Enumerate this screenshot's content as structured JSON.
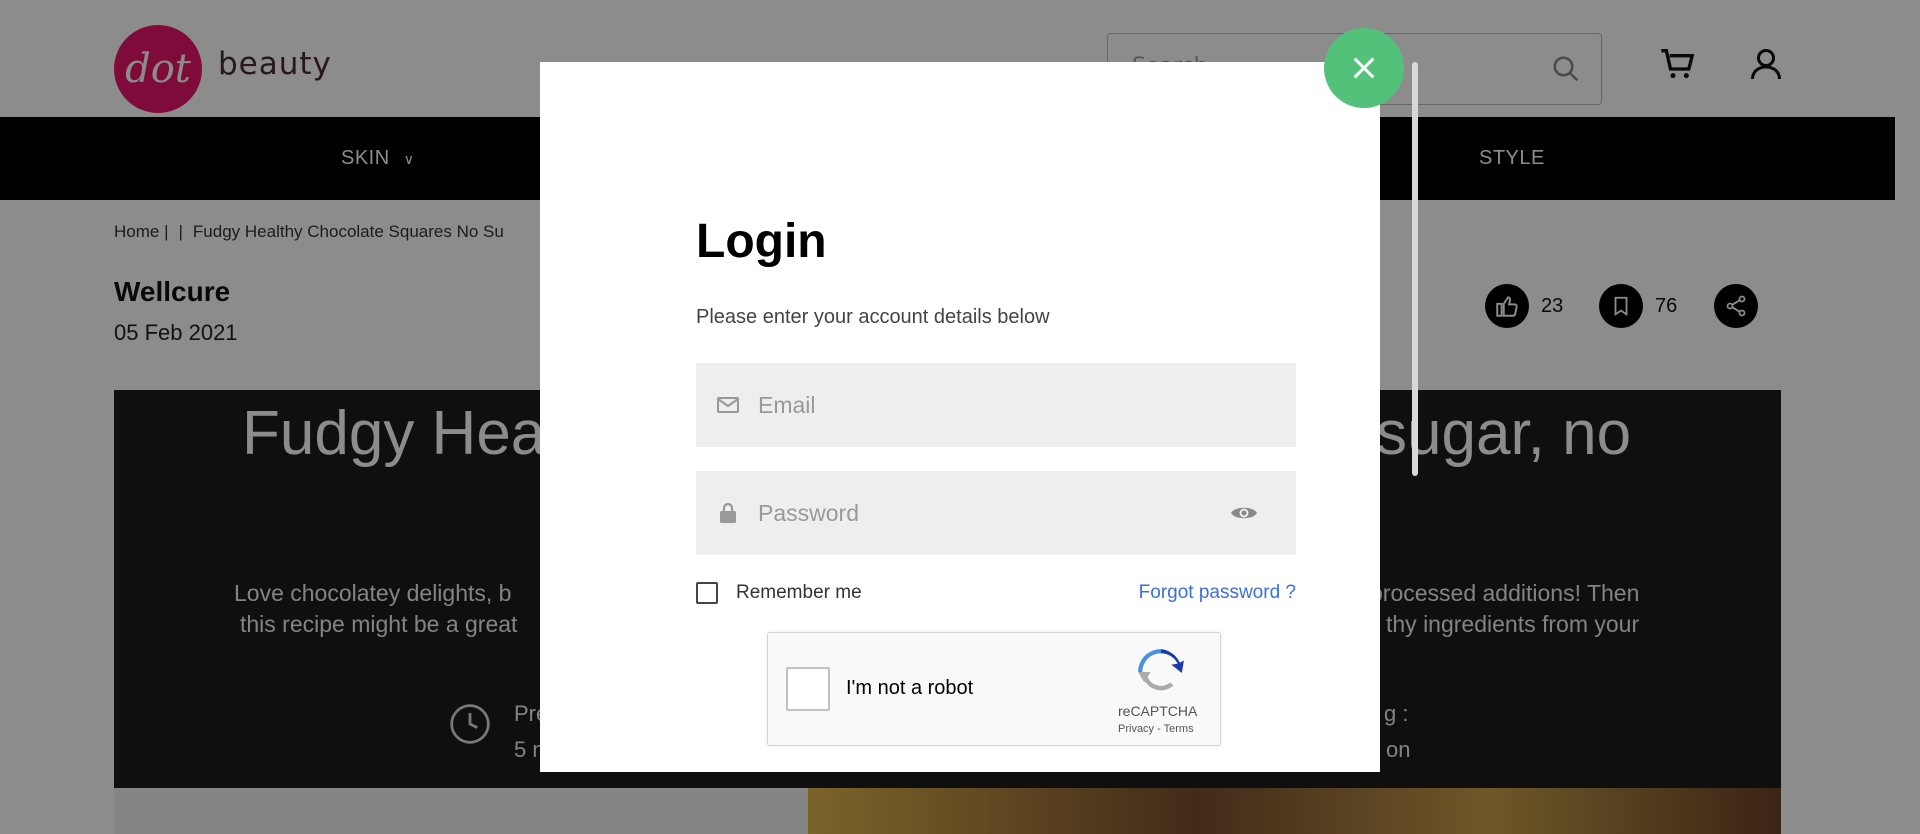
{
  "header": {
    "logo_mark": "dot",
    "logo_text": "beauty",
    "search_placeholder": "Search...",
    "icons": [
      "search-icon",
      "cart-icon",
      "user-icon"
    ]
  },
  "nav": {
    "items": [
      {
        "label": "SKIN",
        "has_dropdown": true
      },
      {
        "label": "STYLE",
        "has_dropdown": false
      }
    ]
  },
  "breadcrumb": {
    "home": "Home |",
    "sep": "|",
    "current": "Fudgy Healthy Chocolate Squares No Su"
  },
  "article": {
    "author": "Wellcure",
    "date": "05 Feb 2021",
    "likes": "23",
    "bookmarks": "76",
    "hero_title_left": "Fudgy Hea",
    "hero_title_right": "sugar, no",
    "desc_line1_left": "Love chocolatey delights, b",
    "desc_line1_right": "processed additions! Then",
    "desc_line2_left": "this recipe might be a great",
    "desc_line2_right": "thy ingredients from your",
    "prep_label": "Pre",
    "prep_value": "5 m",
    "right_label": "g :",
    "right_value": "on"
  },
  "modal": {
    "title": "Login",
    "subtitle": "Please enter your account details below",
    "email_placeholder": "Email",
    "password_placeholder": "Password",
    "remember_label": "Remember me",
    "forgot_label": "Forgot password ?",
    "captcha": {
      "label": "I'm not a robot",
      "brand": "reCAPTCHA",
      "privacy": "Privacy",
      "dash": "-",
      "terms": "Terms"
    }
  },
  "colors": {
    "brand": "#e8146c",
    "close_button": "#52c27a",
    "link": "#3b6fd9",
    "nav_bg": "#000000",
    "hero_bg": "#1c1c1c"
  }
}
